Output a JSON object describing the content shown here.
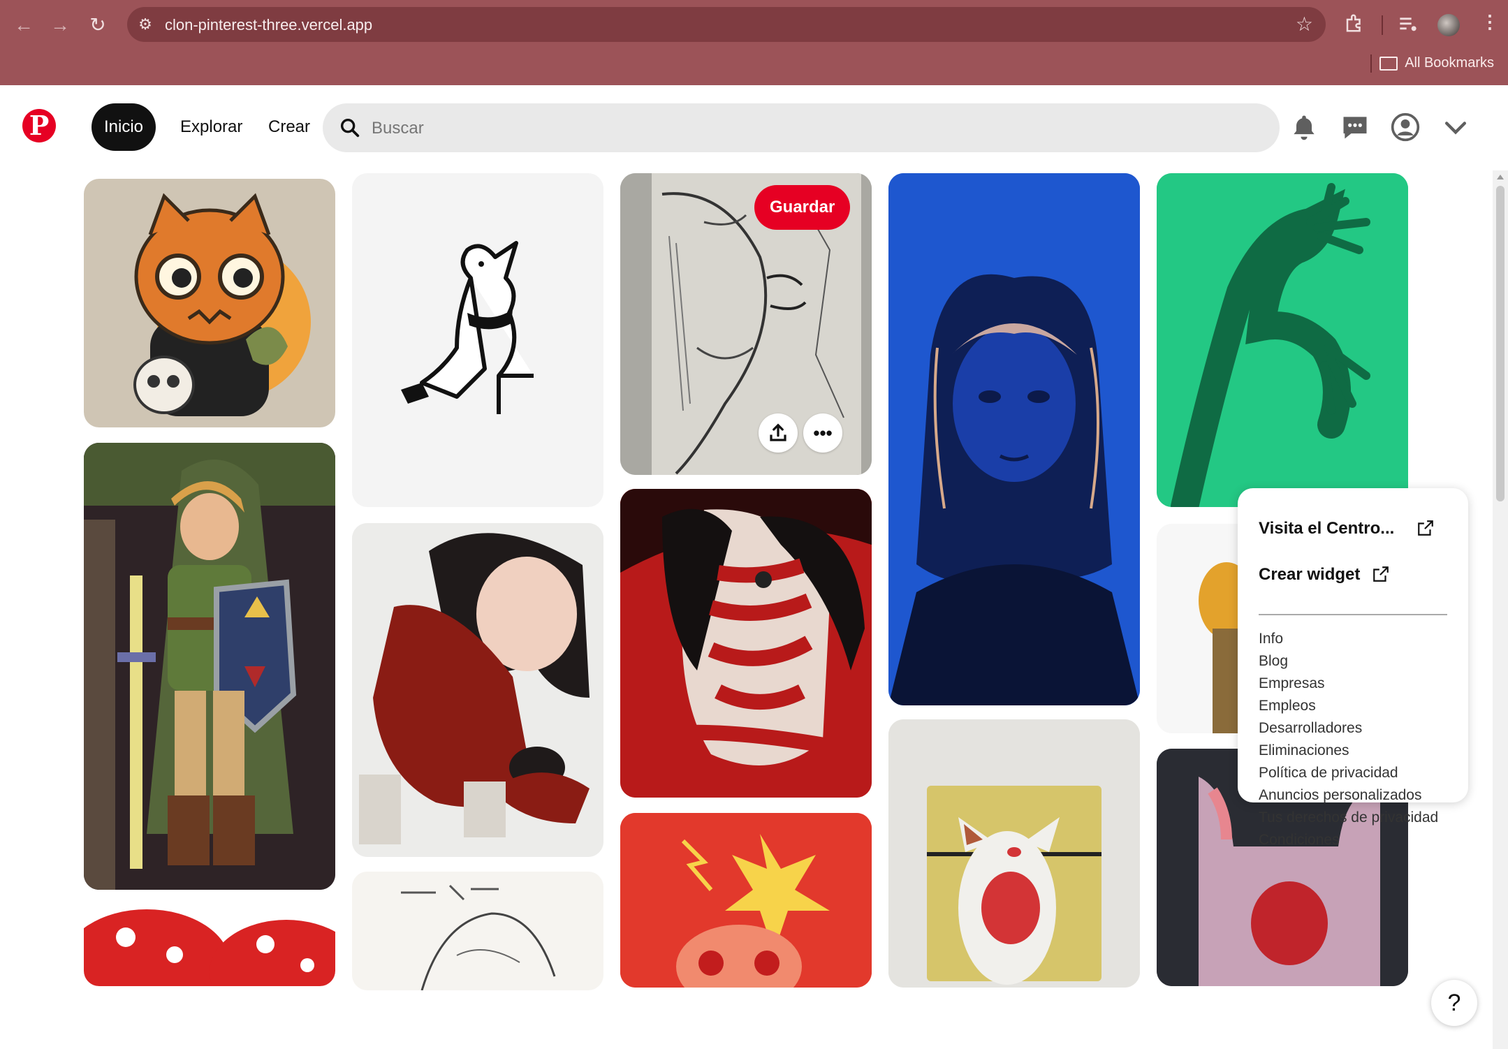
{
  "browser": {
    "url": "clon-pinterest-three.vercel.app",
    "bookmarks_label": "All Bookmarks"
  },
  "header": {
    "nav": [
      "Inicio",
      "Explorar",
      "Crear"
    ],
    "search_placeholder": "Buscar",
    "brand_color": "#e60023"
  },
  "pin_overlay": {
    "save_label": "Guardar"
  },
  "popup": {
    "visit_center": "Visita el Centro...",
    "create_widget": "Crear widget",
    "links": [
      "Info",
      "Blog",
      "Empresas",
      "Empleos",
      "Desarrolladores",
      "Eliminaciones",
      "Política de privacidad",
      "Anuncios personalizados",
      "Tus derechos de privacidad",
      "Condiciones"
    ]
  },
  "help_label": "?"
}
